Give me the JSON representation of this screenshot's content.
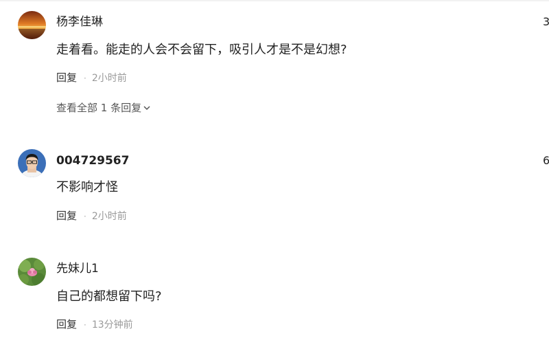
{
  "comments": [
    {
      "username": "杨李佳琳",
      "text": "走着看。能走的人会不会留下，吸引人才是不是幻想?",
      "reply_label": "回复",
      "separator": "·",
      "time": "2小时前",
      "likes": "3",
      "view_all": "查看全部 1 条回复"
    },
    {
      "username": "004729567",
      "text": "不影响才怪",
      "reply_label": "回复",
      "separator": "·",
      "time": "2小时前",
      "likes": "6"
    },
    {
      "username": "先妹儿1",
      "text": "自己的都想留下吗?",
      "reply_label": "回复",
      "separator": "·",
      "time": "13分钟前"
    }
  ],
  "icons": {
    "expand": "chevron-down-icon"
  }
}
